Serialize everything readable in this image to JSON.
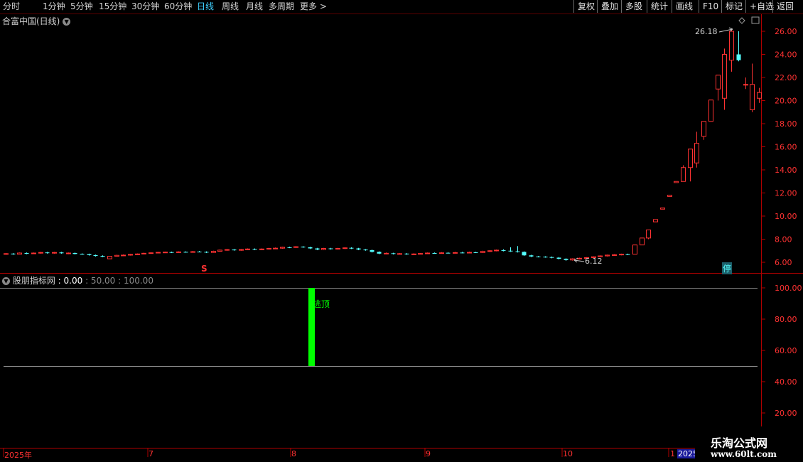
{
  "toolbar": {
    "periods": [
      "分时",
      "1分钟",
      "5分钟",
      "15分钟",
      "30分钟",
      "60分钟",
      "日线",
      "周线",
      "月线",
      "多周期",
      "更多 >"
    ],
    "active": "日线",
    "right_buttons": [
      "复权",
      "叠加",
      "多股",
      "统计",
      "画线",
      "F10",
      "标记",
      "+自选",
      "返回"
    ]
  },
  "main_panel": {
    "title": "合富中国(日线)",
    "y_ticks": [
      "26.00",
      "24.00",
      "22.00",
      "20.00",
      "18.00",
      "16.00",
      "14.00",
      "12.00",
      "10.00",
      "8.00",
      "6.00"
    ],
    "high_label": "26.18",
    "low_label": "6.12",
    "marker_s": "S",
    "marker_stop": "停"
  },
  "indicator_panel": {
    "title": "股朋指标网",
    "values_text": ": 0.00",
    "levels_text": ": 50.00 : 100.00",
    "y_ticks": [
      "100.00",
      "80.00",
      "60.00",
      "40.00",
      "20.00"
    ],
    "signal_text": "逃顶",
    "signal_bar": {
      "from": 50,
      "to": 100
    }
  },
  "time_axis": {
    "labels": [
      "2025年",
      "7",
      "8",
      "9",
      "10",
      "1",
      "2025"
    ]
  },
  "watermark": {
    "line1": "乐淘公式网",
    "line2": "www.60lt.com"
  },
  "colors": {
    "up": "#ff3232",
    "down": "#54ffff",
    "signal": "#00ff00",
    "axis": "#b00000"
  },
  "chart_data": {
    "type": "candlestick",
    "title": "合富中国(日线)",
    "price_range": [
      5.2,
      27.2
    ],
    "candles": [
      {
        "o": 6.7,
        "c": 6.75,
        "h": 6.8,
        "l": 6.65
      },
      {
        "o": 6.75,
        "c": 6.7,
        "h": 6.8,
        "l": 6.65
      },
      {
        "o": 6.7,
        "c": 6.8,
        "h": 6.85,
        "l": 6.68
      },
      {
        "o": 6.8,
        "c": 6.75,
        "h": 6.85,
        "l": 6.7
      },
      {
        "o": 6.75,
        "c": 6.8,
        "h": 6.85,
        "l": 6.72
      },
      {
        "o": 6.8,
        "c": 6.85,
        "h": 6.9,
        "l": 6.75
      },
      {
        "o": 6.85,
        "c": 6.8,
        "h": 6.9,
        "l": 6.75
      },
      {
        "o": 6.8,
        "c": 6.85,
        "h": 6.9,
        "l": 6.75
      },
      {
        "o": 6.85,
        "c": 6.78,
        "h": 6.9,
        "l": 6.75
      },
      {
        "o": 6.78,
        "c": 6.8,
        "h": 6.85,
        "l": 6.7
      },
      {
        "o": 6.8,
        "c": 6.72,
        "h": 6.85,
        "l": 6.68
      },
      {
        "o": 6.72,
        "c": 6.7,
        "h": 6.78,
        "l": 6.65
      },
      {
        "o": 6.7,
        "c": 6.62,
        "h": 6.75,
        "l": 6.58
      },
      {
        "o": 6.62,
        "c": 6.55,
        "h": 6.66,
        "l": 6.5
      },
      {
        "o": 6.55,
        "c": 6.48,
        "h": 6.6,
        "l": 6.45
      },
      {
        "o": 6.3,
        "c": 6.52,
        "h": 6.55,
        "l": 6.28
      },
      {
        "o": 6.52,
        "c": 6.6,
        "h": 6.65,
        "l": 6.5
      },
      {
        "o": 6.6,
        "c": 6.62,
        "h": 6.68,
        "l": 6.55
      },
      {
        "o": 6.62,
        "c": 6.68,
        "h": 6.72,
        "l": 6.58
      },
      {
        "o": 6.68,
        "c": 6.72,
        "h": 6.76,
        "l": 6.64
      },
      {
        "o": 6.72,
        "c": 6.78,
        "h": 6.82,
        "l": 6.7
      },
      {
        "o": 6.78,
        "c": 6.82,
        "h": 6.86,
        "l": 6.74
      },
      {
        "o": 6.82,
        "c": 6.86,
        "h": 6.9,
        "l": 6.78
      },
      {
        "o": 6.86,
        "c": 6.88,
        "h": 6.92,
        "l": 6.82
      },
      {
        "o": 6.88,
        "c": 6.85,
        "h": 6.92,
        "l": 6.8
      },
      {
        "o": 6.85,
        "c": 6.9,
        "h": 6.95,
        "l": 6.82
      },
      {
        "o": 6.9,
        "c": 6.88,
        "h": 6.95,
        "l": 6.84
      },
      {
        "o": 6.88,
        "c": 6.92,
        "h": 6.98,
        "l": 6.86
      },
      {
        "o": 6.92,
        "c": 6.9,
        "h": 6.98,
        "l": 6.86
      },
      {
        "o": 6.9,
        "c": 6.85,
        "h": 6.95,
        "l": 6.8
      },
      {
        "o": 6.85,
        "c": 6.95,
        "h": 7.0,
        "l": 6.82
      },
      {
        "o": 6.95,
        "c": 7.05,
        "h": 7.1,
        "l": 6.92
      },
      {
        "o": 7.05,
        "c": 7.1,
        "h": 7.15,
        "l": 7.0
      },
      {
        "o": 7.1,
        "c": 7.05,
        "h": 7.15,
        "l": 7.0
      },
      {
        "o": 7.05,
        "c": 7.1,
        "h": 7.15,
        "l": 7.0
      },
      {
        "o": 7.1,
        "c": 7.15,
        "h": 7.2,
        "l": 7.05
      },
      {
        "o": 7.15,
        "c": 7.1,
        "h": 7.2,
        "l": 7.05
      },
      {
        "o": 7.1,
        "c": 7.15,
        "h": 7.2,
        "l": 7.05
      },
      {
        "o": 7.15,
        "c": 7.2,
        "h": 7.25,
        "l": 7.1
      },
      {
        "o": 7.2,
        "c": 7.22,
        "h": 7.28,
        "l": 7.15
      },
      {
        "o": 7.22,
        "c": 7.3,
        "h": 7.35,
        "l": 7.18
      },
      {
        "o": 7.3,
        "c": 7.28,
        "h": 7.35,
        "l": 7.22
      },
      {
        "o": 7.28,
        "c": 7.35,
        "h": 7.4,
        "l": 7.25
      },
      {
        "o": 7.35,
        "c": 7.3,
        "h": 7.4,
        "l": 7.25
      },
      {
        "o": 7.3,
        "c": 7.2,
        "h": 7.35,
        "l": 7.15
      },
      {
        "o": 7.2,
        "c": 7.1,
        "h": 7.25,
        "l": 7.05
      },
      {
        "o": 7.1,
        "c": 7.2,
        "h": 7.25,
        "l": 7.05
      },
      {
        "o": 7.2,
        "c": 7.15,
        "h": 7.25,
        "l": 7.1
      },
      {
        "o": 7.15,
        "c": 7.2,
        "h": 7.25,
        "l": 7.1
      },
      {
        "o": 7.2,
        "c": 7.25,
        "h": 7.3,
        "l": 7.15
      },
      {
        "o": 7.25,
        "c": 7.2,
        "h": 7.3,
        "l": 7.15
      },
      {
        "o": 7.2,
        "c": 7.1,
        "h": 7.25,
        "l": 7.05
      },
      {
        "o": 7.1,
        "c": 7.05,
        "h": 7.15,
        "l": 7.0
      },
      {
        "o": 7.05,
        "c": 6.9,
        "h": 7.1,
        "l": 6.85
      },
      {
        "o": 6.9,
        "c": 6.75,
        "h": 6.95,
        "l": 6.7
      },
      {
        "o": 6.75,
        "c": 6.78,
        "h": 6.85,
        "l": 6.7
      },
      {
        "o": 6.78,
        "c": 6.72,
        "h": 6.82,
        "l": 6.68
      },
      {
        "o": 6.72,
        "c": 6.75,
        "h": 6.8,
        "l": 6.68
      },
      {
        "o": 6.75,
        "c": 6.7,
        "h": 6.8,
        "l": 6.65
      },
      {
        "o": 6.7,
        "c": 6.72,
        "h": 6.78,
        "l": 6.66
      },
      {
        "o": 6.72,
        "c": 6.76,
        "h": 6.8,
        "l": 6.68
      },
      {
        "o": 6.76,
        "c": 6.8,
        "h": 6.85,
        "l": 6.72
      },
      {
        "o": 6.8,
        "c": 6.78,
        "h": 6.85,
        "l": 6.74
      },
      {
        "o": 6.78,
        "c": 6.82,
        "h": 6.88,
        "l": 6.75
      },
      {
        "o": 6.82,
        "c": 6.8,
        "h": 6.88,
        "l": 6.76
      },
      {
        "o": 6.8,
        "c": 6.84,
        "h": 6.9,
        "l": 6.78
      },
      {
        "o": 6.84,
        "c": 6.82,
        "h": 6.9,
        "l": 6.78
      },
      {
        "o": 6.82,
        "c": 6.86,
        "h": 6.92,
        "l": 6.8
      },
      {
        "o": 6.86,
        "c": 6.84,
        "h": 6.9,
        "l": 6.8
      },
      {
        "o": 6.84,
        "c": 6.95,
        "h": 7.0,
        "l": 6.8
      },
      {
        "o": 6.95,
        "c": 7.0,
        "h": 7.05,
        "l": 6.9
      },
      {
        "o": 7.0,
        "c": 7.05,
        "h": 7.1,
        "l": 6.95
      },
      {
        "o": 7.05,
        "c": 7.0,
        "h": 7.12,
        "l": 6.95
      },
      {
        "o": 7.0,
        "c": 6.95,
        "h": 7.3,
        "l": 6.9
      },
      {
        "o": 6.95,
        "c": 6.9,
        "h": 7.4,
        "l": 6.85
      },
      {
        "o": 6.9,
        "c": 6.6,
        "h": 6.95,
        "l": 6.55
      },
      {
        "o": 6.6,
        "c": 6.5,
        "h": 6.65,
        "l": 6.45
      },
      {
        "o": 6.5,
        "c": 6.48,
        "h": 6.55,
        "l": 6.42
      },
      {
        "o": 6.48,
        "c": 6.45,
        "h": 6.52,
        "l": 6.4
      },
      {
        "o": 6.45,
        "c": 6.4,
        "h": 6.5,
        "l": 6.35
      },
      {
        "o": 6.4,
        "c": 6.3,
        "h": 6.45,
        "l": 6.25
      },
      {
        "o": 6.3,
        "c": 6.2,
        "h": 6.35,
        "l": 6.12
      },
      {
        "o": 6.2,
        "c": 6.3,
        "h": 6.35,
        "l": 6.15
      },
      {
        "o": 6.3,
        "c": 6.35,
        "h": 6.4,
        "l": 6.25
      },
      {
        "o": 6.35,
        "c": 6.4,
        "h": 6.45,
        "l": 6.3
      },
      {
        "o": 6.4,
        "c": 6.48,
        "h": 6.52,
        "l": 6.36
      },
      {
        "o": 6.48,
        "c": 6.55,
        "h": 6.6,
        "l": 6.45
      },
      {
        "o": 6.55,
        "c": 6.62,
        "h": 6.66,
        "l": 6.5
      },
      {
        "o": 6.62,
        "c": 6.65,
        "h": 6.7,
        "l": 6.58
      },
      {
        "o": 6.65,
        "c": 6.7,
        "h": 6.75,
        "l": 6.6
      },
      {
        "o": 6.7,
        "c": 6.68,
        "h": 6.75,
        "l": 6.62
      },
      {
        "o": 6.7,
        "c": 7.5,
        "h": 7.5,
        "l": 6.7
      },
      {
        "o": 7.5,
        "c": 8.1,
        "h": 8.1,
        "l": 7.5
      },
      {
        "o": 8.1,
        "c": 8.8,
        "h": 8.8,
        "l": 8.0
      },
      {
        "o": 9.5,
        "c": 9.7,
        "h": 9.7,
        "l": 9.5
      },
      {
        "o": 10.6,
        "c": 10.7,
        "h": 10.7,
        "l": 10.6
      },
      {
        "o": 11.7,
        "c": 11.8,
        "h": 11.8,
        "l": 11.7
      },
      {
        "o": 12.9,
        "c": 13.0,
        "h": 13.0,
        "l": 12.9
      },
      {
        "o": 13.0,
        "c": 14.2,
        "h": 14.4,
        "l": 13.0
      },
      {
        "o": 14.2,
        "c": 15.8,
        "h": 15.8,
        "l": 13.0
      },
      {
        "o": 14.6,
        "c": 16.3,
        "h": 17.3,
        "l": 14.2
      },
      {
        "o": 16.9,
        "c": 18.2,
        "h": 18.2,
        "l": 16.6
      },
      {
        "o": 18.2,
        "c": 20.05,
        "h": 20.05,
        "l": 18.5
      },
      {
        "o": 21.0,
        "c": 22.2,
        "h": 22.2,
        "l": 20.0
      },
      {
        "o": 20.2,
        "c": 24.0,
        "h": 24.5,
        "l": 19.2
      },
      {
        "o": 23.5,
        "c": 26.0,
        "h": 26.18,
        "l": 22.5
      },
      {
        "o": 24.0,
        "c": 23.5,
        "h": 26.0,
        "l": 23.4
      },
      {
        "o": 21.4,
        "c": 21.4,
        "h": 22.0,
        "l": 21.0
      },
      {
        "o": 19.2,
        "c": 21.4,
        "h": 23.2,
        "l": 19.0
      },
      {
        "o": 20.2,
        "c": 20.7,
        "h": 21.1,
        "l": 19.8
      }
    ]
  }
}
